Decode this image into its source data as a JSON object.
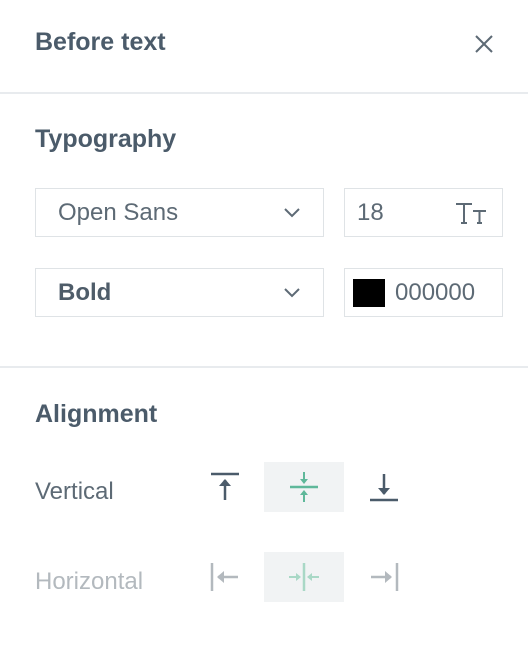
{
  "header": {
    "title": "Before text"
  },
  "typography": {
    "title": "Typography",
    "font_family": "Open Sans",
    "font_size": "18",
    "font_weight": "Bold",
    "color_hex": "000000",
    "color_swatch": "#000000"
  },
  "alignment": {
    "title": "Alignment",
    "vertical_label": "Vertical",
    "horizontal_label": "Horizontal",
    "vertical_selected": "middle",
    "horizontal_selected": "center",
    "horizontal_disabled": true
  },
  "icons": {
    "close": "close-icon",
    "text_size": "text-size-icon",
    "chevron": "chevron-down-icon",
    "align_top": "align-top-icon",
    "align_middle": "align-middle-icon",
    "align_bottom": "align-bottom-icon",
    "align_left": "align-left-icon",
    "align_center": "align-center-icon",
    "align_right": "align-right-icon"
  },
  "colors": {
    "accent": "#5fb89a",
    "text": "#4b5b6a",
    "disabled": "#b3b9be"
  }
}
